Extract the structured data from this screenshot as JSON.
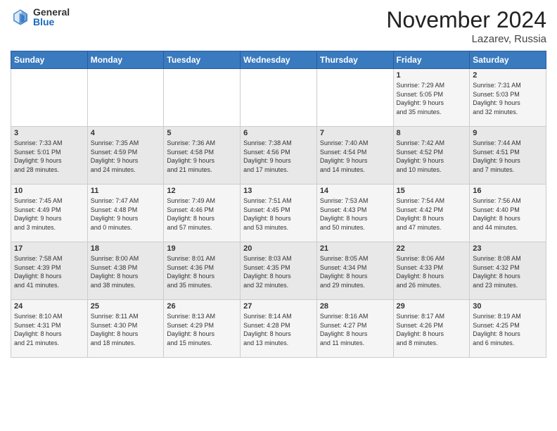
{
  "header": {
    "logo_general": "General",
    "logo_blue": "Blue",
    "month_title": "November 2024",
    "location": "Lazarev, Russia"
  },
  "days_of_week": [
    "Sunday",
    "Monday",
    "Tuesday",
    "Wednesday",
    "Thursday",
    "Friday",
    "Saturday"
  ],
  "weeks": [
    [
      {
        "day": "",
        "info": ""
      },
      {
        "day": "",
        "info": ""
      },
      {
        "day": "",
        "info": ""
      },
      {
        "day": "",
        "info": ""
      },
      {
        "day": "",
        "info": ""
      },
      {
        "day": "1",
        "info": "Sunrise: 7:29 AM\nSunset: 5:05 PM\nDaylight: 9 hours\nand 35 minutes."
      },
      {
        "day": "2",
        "info": "Sunrise: 7:31 AM\nSunset: 5:03 PM\nDaylight: 9 hours\nand 32 minutes."
      }
    ],
    [
      {
        "day": "3",
        "info": "Sunrise: 7:33 AM\nSunset: 5:01 PM\nDaylight: 9 hours\nand 28 minutes."
      },
      {
        "day": "4",
        "info": "Sunrise: 7:35 AM\nSunset: 4:59 PM\nDaylight: 9 hours\nand 24 minutes."
      },
      {
        "day": "5",
        "info": "Sunrise: 7:36 AM\nSunset: 4:58 PM\nDaylight: 9 hours\nand 21 minutes."
      },
      {
        "day": "6",
        "info": "Sunrise: 7:38 AM\nSunset: 4:56 PM\nDaylight: 9 hours\nand 17 minutes."
      },
      {
        "day": "7",
        "info": "Sunrise: 7:40 AM\nSunset: 4:54 PM\nDaylight: 9 hours\nand 14 minutes."
      },
      {
        "day": "8",
        "info": "Sunrise: 7:42 AM\nSunset: 4:52 PM\nDaylight: 9 hours\nand 10 minutes."
      },
      {
        "day": "9",
        "info": "Sunrise: 7:44 AM\nSunset: 4:51 PM\nDaylight: 9 hours\nand 7 minutes."
      }
    ],
    [
      {
        "day": "10",
        "info": "Sunrise: 7:45 AM\nSunset: 4:49 PM\nDaylight: 9 hours\nand 3 minutes."
      },
      {
        "day": "11",
        "info": "Sunrise: 7:47 AM\nSunset: 4:48 PM\nDaylight: 9 hours\nand 0 minutes."
      },
      {
        "day": "12",
        "info": "Sunrise: 7:49 AM\nSunset: 4:46 PM\nDaylight: 8 hours\nand 57 minutes."
      },
      {
        "day": "13",
        "info": "Sunrise: 7:51 AM\nSunset: 4:45 PM\nDaylight: 8 hours\nand 53 minutes."
      },
      {
        "day": "14",
        "info": "Sunrise: 7:53 AM\nSunset: 4:43 PM\nDaylight: 8 hours\nand 50 minutes."
      },
      {
        "day": "15",
        "info": "Sunrise: 7:54 AM\nSunset: 4:42 PM\nDaylight: 8 hours\nand 47 minutes."
      },
      {
        "day": "16",
        "info": "Sunrise: 7:56 AM\nSunset: 4:40 PM\nDaylight: 8 hours\nand 44 minutes."
      }
    ],
    [
      {
        "day": "17",
        "info": "Sunrise: 7:58 AM\nSunset: 4:39 PM\nDaylight: 8 hours\nand 41 minutes."
      },
      {
        "day": "18",
        "info": "Sunrise: 8:00 AM\nSunset: 4:38 PM\nDaylight: 8 hours\nand 38 minutes."
      },
      {
        "day": "19",
        "info": "Sunrise: 8:01 AM\nSunset: 4:36 PM\nDaylight: 8 hours\nand 35 minutes."
      },
      {
        "day": "20",
        "info": "Sunrise: 8:03 AM\nSunset: 4:35 PM\nDaylight: 8 hours\nand 32 minutes."
      },
      {
        "day": "21",
        "info": "Sunrise: 8:05 AM\nSunset: 4:34 PM\nDaylight: 8 hours\nand 29 minutes."
      },
      {
        "day": "22",
        "info": "Sunrise: 8:06 AM\nSunset: 4:33 PM\nDaylight: 8 hours\nand 26 minutes."
      },
      {
        "day": "23",
        "info": "Sunrise: 8:08 AM\nSunset: 4:32 PM\nDaylight: 8 hours\nand 23 minutes."
      }
    ],
    [
      {
        "day": "24",
        "info": "Sunrise: 8:10 AM\nSunset: 4:31 PM\nDaylight: 8 hours\nand 21 minutes."
      },
      {
        "day": "25",
        "info": "Sunrise: 8:11 AM\nSunset: 4:30 PM\nDaylight: 8 hours\nand 18 minutes."
      },
      {
        "day": "26",
        "info": "Sunrise: 8:13 AM\nSunset: 4:29 PM\nDaylight: 8 hours\nand 15 minutes."
      },
      {
        "day": "27",
        "info": "Sunrise: 8:14 AM\nSunset: 4:28 PM\nDaylight: 8 hours\nand 13 minutes."
      },
      {
        "day": "28",
        "info": "Sunrise: 8:16 AM\nSunset: 4:27 PM\nDaylight: 8 hours\nand 11 minutes."
      },
      {
        "day": "29",
        "info": "Sunrise: 8:17 AM\nSunset: 4:26 PM\nDaylight: 8 hours\nand 8 minutes."
      },
      {
        "day": "30",
        "info": "Sunrise: 8:19 AM\nSunset: 4:25 PM\nDaylight: 8 hours\nand 6 minutes."
      }
    ]
  ]
}
